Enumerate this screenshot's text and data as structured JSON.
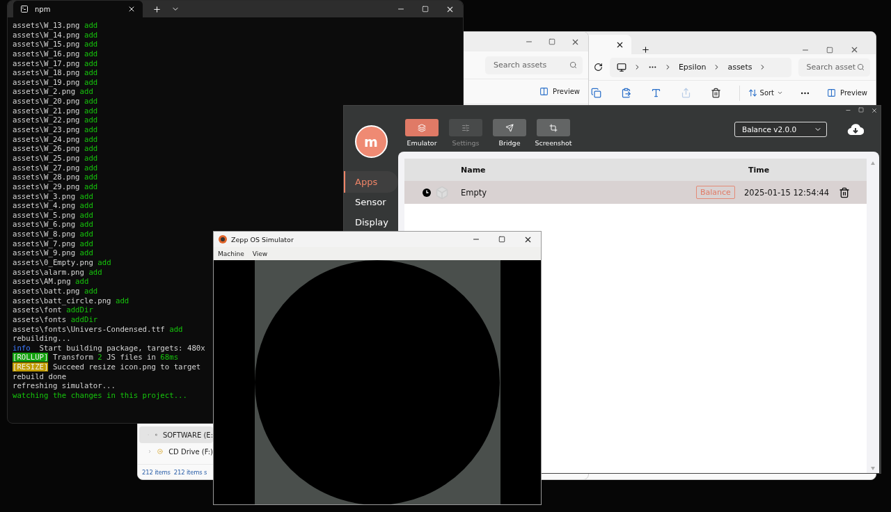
{
  "explorer_back": {
    "search": {
      "placeholder": "Search assets"
    },
    "preview": "Preview",
    "nav_items": [
      {
        "label": "SOFTWARE (E:",
        "kind": "drive",
        "selected": true
      },
      {
        "label": "CD Drive (F:)",
        "kind": "cd",
        "selected": false
      }
    ],
    "status": [
      "212 items",
      "212 items s"
    ]
  },
  "explorer_front": {
    "breadcrumb": [
      "Epsilon",
      "assets"
    ],
    "search": {
      "placeholder": "Search asset"
    },
    "actions": [
      {
        "kind": "copy",
        "disabled": false
      },
      {
        "kind": "paste",
        "disabled": false
      },
      {
        "kind": "rename",
        "disabled": false
      },
      {
        "kind": "share",
        "disabled": true
      },
      {
        "kind": "delete",
        "disabled": false
      }
    ],
    "sort": "Sort",
    "preview": "Preview"
  },
  "terminal": {
    "tab": "npm",
    "lines": [
      {
        "segments": [
          {
            "text": "assets\\W_13.png ",
            "kind": "plain"
          },
          {
            "text": "add",
            "kind": "green"
          }
        ]
      },
      {
        "segments": [
          {
            "text": "assets\\W_14.png ",
            "kind": "plain"
          },
          {
            "text": "add",
            "kind": "green"
          }
        ]
      },
      {
        "segments": [
          {
            "text": "assets\\W_15.png ",
            "kind": "plain"
          },
          {
            "text": "add",
            "kind": "green"
          }
        ]
      },
      {
        "segments": [
          {
            "text": "assets\\W_16.png ",
            "kind": "plain"
          },
          {
            "text": "add",
            "kind": "green"
          }
        ]
      },
      {
        "segments": [
          {
            "text": "assets\\W_17.png ",
            "kind": "plain"
          },
          {
            "text": "add",
            "kind": "green"
          }
        ]
      },
      {
        "segments": [
          {
            "text": "assets\\W_18.png ",
            "kind": "plain"
          },
          {
            "text": "add",
            "kind": "green"
          }
        ]
      },
      {
        "segments": [
          {
            "text": "assets\\W_19.png ",
            "kind": "plain"
          },
          {
            "text": "add",
            "kind": "green"
          }
        ]
      },
      {
        "segments": [
          {
            "text": "assets\\W_2.png ",
            "kind": "plain"
          },
          {
            "text": "add",
            "kind": "green"
          }
        ]
      },
      {
        "segments": [
          {
            "text": "assets\\W_20.png ",
            "kind": "plain"
          },
          {
            "text": "add",
            "kind": "green"
          }
        ]
      },
      {
        "segments": [
          {
            "text": "assets\\W_21.png ",
            "kind": "plain"
          },
          {
            "text": "add",
            "kind": "green"
          }
        ]
      },
      {
        "segments": [
          {
            "text": "assets\\W_22.png ",
            "kind": "plain"
          },
          {
            "text": "add",
            "kind": "green"
          }
        ]
      },
      {
        "segments": [
          {
            "text": "assets\\W_23.png ",
            "kind": "plain"
          },
          {
            "text": "add",
            "kind": "green"
          }
        ]
      },
      {
        "segments": [
          {
            "text": "assets\\W_24.png ",
            "kind": "plain"
          },
          {
            "text": "add",
            "kind": "green"
          }
        ]
      },
      {
        "segments": [
          {
            "text": "assets\\W_26.png ",
            "kind": "plain"
          },
          {
            "text": "add",
            "kind": "green"
          }
        ]
      },
      {
        "segments": [
          {
            "text": "assets\\W_25.png ",
            "kind": "plain"
          },
          {
            "text": "add",
            "kind": "green"
          }
        ]
      },
      {
        "segments": [
          {
            "text": "assets\\W_27.png ",
            "kind": "plain"
          },
          {
            "text": "add",
            "kind": "green"
          }
        ]
      },
      {
        "segments": [
          {
            "text": "assets\\W_28.png ",
            "kind": "plain"
          },
          {
            "text": "add",
            "kind": "green"
          }
        ]
      },
      {
        "segments": [
          {
            "text": "assets\\W_29.png ",
            "kind": "plain"
          },
          {
            "text": "add",
            "kind": "green"
          }
        ]
      },
      {
        "segments": [
          {
            "text": "assets\\W_3.png ",
            "kind": "plain"
          },
          {
            "text": "add",
            "kind": "green"
          }
        ]
      },
      {
        "segments": [
          {
            "text": "assets\\W_4.png ",
            "kind": "plain"
          },
          {
            "text": "add",
            "kind": "green"
          }
        ]
      },
      {
        "segments": [
          {
            "text": "assets\\W_5.png ",
            "kind": "plain"
          },
          {
            "text": "add",
            "kind": "green"
          }
        ]
      },
      {
        "segments": [
          {
            "text": "assets\\W_6.png ",
            "kind": "plain"
          },
          {
            "text": "add",
            "kind": "green"
          }
        ]
      },
      {
        "segments": [
          {
            "text": "assets\\W_8.png ",
            "kind": "plain"
          },
          {
            "text": "add",
            "kind": "green"
          }
        ]
      },
      {
        "segments": [
          {
            "text": "assets\\W_7.png ",
            "kind": "plain"
          },
          {
            "text": "add",
            "kind": "green"
          }
        ]
      },
      {
        "segments": [
          {
            "text": "assets\\W_9.png ",
            "kind": "plain"
          },
          {
            "text": "add",
            "kind": "green"
          }
        ]
      },
      {
        "segments": [
          {
            "text": "assets\\0_Empty.png ",
            "kind": "plain"
          },
          {
            "text": "add",
            "kind": "green"
          }
        ]
      },
      {
        "segments": [
          {
            "text": "assets\\alarm.png ",
            "kind": "plain"
          },
          {
            "text": "add",
            "kind": "green"
          }
        ]
      },
      {
        "segments": [
          {
            "text": "assets\\AM.png ",
            "kind": "plain"
          },
          {
            "text": "add",
            "kind": "green"
          }
        ]
      },
      {
        "segments": [
          {
            "text": "assets\\batt.png ",
            "kind": "plain"
          },
          {
            "text": "add",
            "kind": "green"
          }
        ]
      },
      {
        "segments": [
          {
            "text": "assets\\batt_circle.png ",
            "kind": "plain"
          },
          {
            "text": "add",
            "kind": "green"
          }
        ]
      },
      {
        "segments": [
          {
            "text": "assets\\font ",
            "kind": "plain"
          },
          {
            "text": "addDir",
            "kind": "green"
          }
        ]
      },
      {
        "segments": [
          {
            "text": "assets\\fonts ",
            "kind": "plain"
          },
          {
            "text": "addDir",
            "kind": "green"
          }
        ]
      },
      {
        "segments": [
          {
            "text": "assets\\fonts\\Univers-Condensed.ttf ",
            "kind": "plain"
          },
          {
            "text": "add",
            "kind": "green"
          }
        ]
      },
      {
        "segments": [
          {
            "text": "rebuilding...",
            "kind": "plain"
          }
        ]
      },
      {
        "segments": [
          {
            "text": "info",
            "kind": "blue"
          },
          {
            "text": "  Start building package, targets: 480x",
            "kind": "plain"
          }
        ]
      },
      {
        "segments": [
          {
            "text": "[ROLLUP]",
            "kind": "tag_green"
          },
          {
            "text": " Transform ",
            "kind": "plain"
          },
          {
            "text": "2",
            "kind": "green"
          },
          {
            "text": " JS files in ",
            "kind": "plain"
          },
          {
            "text": "68ms",
            "kind": "green"
          }
        ]
      },
      {
        "segments": [
          {
            "text": "[RESIZE]",
            "kind": "tag_yellow"
          },
          {
            "text": " Succeed resize icon.png to target",
            "kind": "plain"
          }
        ]
      },
      {
        "segments": [
          {
            "text": "rebuild done",
            "kind": "plain"
          }
        ]
      },
      {
        "segments": [
          {
            "text": "refreshing simulator...",
            "kind": "plain"
          }
        ]
      },
      {
        "segments": [
          {
            "text": "watching the changes in this project...",
            "kind": "green"
          }
        ]
      }
    ]
  },
  "zepp_app": {
    "avatar": "m",
    "tools": [
      {
        "label": "Emulator",
        "kind": "emulator",
        "selected": true,
        "disabled": false
      },
      {
        "label": "Settings",
        "kind": "settings",
        "selected": false,
        "disabled": true
      },
      {
        "label": "Bridge",
        "kind": "bridge",
        "selected": false,
        "disabled": false
      },
      {
        "label": "Screenshot",
        "kind": "screenshot",
        "selected": false,
        "disabled": false
      }
    ],
    "device": "Balance v2.0.0",
    "nav": [
      {
        "label": "Apps",
        "selected": true
      },
      {
        "label": "Sensor",
        "selected": false
      },
      {
        "label": "Display",
        "selected": false
      }
    ],
    "table": {
      "columns": [
        "Name",
        "Time"
      ],
      "rows": [
        {
          "name": "Empty",
          "tag": "Balance",
          "time": "2025-01-15 12:54:44"
        }
      ]
    }
  },
  "simulator": {
    "title": "Zepp OS Simulator",
    "menu": [
      "Machine",
      "View"
    ]
  }
}
